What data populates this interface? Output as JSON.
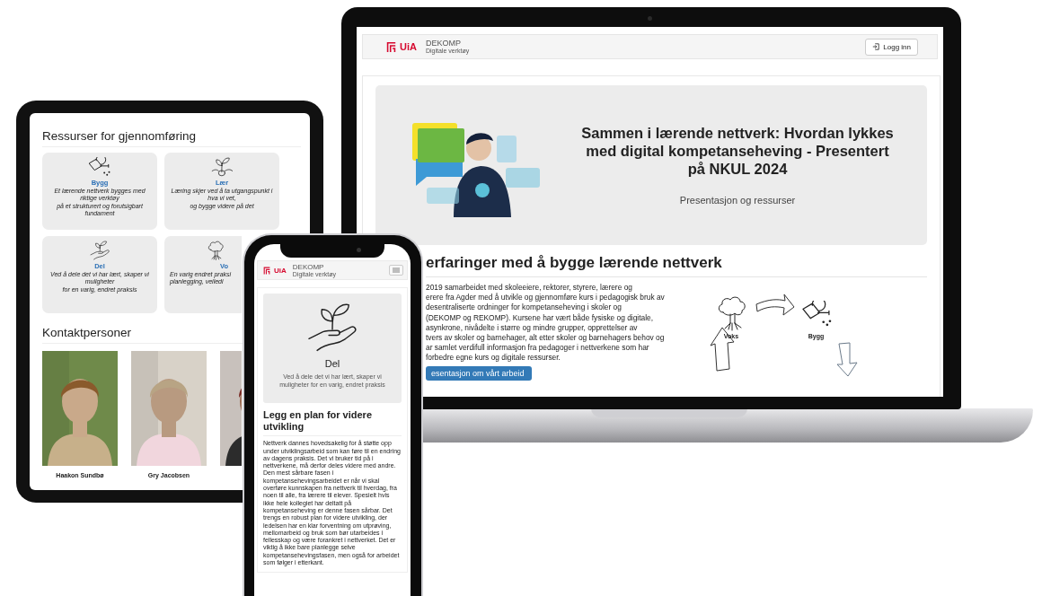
{
  "laptop": {
    "header": {
      "logo": "UiA",
      "brand": "DEKOMP",
      "tagline": "Digitale verktøy",
      "login": "Logg inn"
    },
    "hero": {
      "picture": {
        "kind": "picture"
      },
      "title": "Sammen i lærende nettverk: Hvordan lykkes med digital kompetanseheving - Presentert på NKUL 2024",
      "subtitle": "Presentasjon og ressurser"
    },
    "section": {
      "heading": "erfaringer med å bygge lærende nettverk",
      "lines": [
        "2019 samarbeidet med skoleeiere, rektorer, styrere, lærere og",
        "erere fra Agder med å utvikle og gjennomføre kurs i pedagogisk bruk av",
        "desentraliserte ordninger for kompetanseheving i skoler og",
        "(DEKOMP og REKOMP). Kursene har vært både fysiske og digitale,",
        "asynkrone, nivådelte i større og mindre grupper, opprettelser av",
        "tvers av skoler og barnehager, alt etter skoler og barnehagers behov og",
        "ar samlet verdifull informasjon fra pedagoger i nettverkene som har",
        "forbedre egne kurs og digitale ressurser."
      ],
      "button": "esentasjon om vårt arbeid",
      "diagram_labels": [
        "Voks",
        "Bygg"
      ]
    }
  },
  "tablet": {
    "heading": "Ressurser for gjennomføring",
    "cards": [
      {
        "title": "Bygg",
        "lines": [
          "Et lærende nettverk bygges med riktige verktøy",
          "på et strukturert og forutsigbart fundament"
        ]
      },
      {
        "title": "Lær",
        "lines": [
          "Læring skjer ved å ta utgangspunkt i hva vi vet,",
          "og bygge videre på det"
        ]
      },
      {
        "title": "Del",
        "lines": [
          "Ved å dele det vi har lært, skaper vi muligheter",
          "for en varig, endret praksis"
        ]
      },
      {
        "title": "Vo",
        "lines": [
          "En varig endret praksi",
          "planlegging, veiledi"
        ]
      }
    ],
    "contacts_heading": "Kontaktpersoner",
    "contacts": [
      {
        "kind": "picture",
        "name": "Haakon Sundbø"
      },
      {
        "kind": "picture",
        "name": "Gry Jacobsen"
      },
      {
        "kind": "picture"
      }
    ]
  },
  "phone": {
    "header": {
      "logo": "UiA",
      "brand": "DEKOMP",
      "tagline": "Digitale verktøy"
    },
    "card": {
      "title": "Del",
      "text": "Ved å dele det vi har lært, skaper vi muligheter for en varig, endret praksis"
    },
    "heading": "Legg en plan for videre utvikling",
    "paragraph": "Nettverk dannes hovedsakelig for å støtte opp under utviklingsarbeid som kan føre til en endring av dagens praksis. Det vi bruker tid på i nettverkene, må derfor deles videre med andre. Den mest sårbare fasen i kompetansehevingsarbeidet er når vi skal overføre kunnskapen fra nettverk til hverdag, fra noen til alle, fra lærere til elever. Spesielt hvis ikke hele kollegiet har deltatt på kompetanseheving er denne fasen sårbar. Det trengs en robust plan for videre utvikling, der ledelsen har en klar forventning om utprøving, mellomarbeid og bruk som bør utarbeides i fellesskap og være forankret i nettverket. Det er viktig å ikke bare planlegge selve kompetansehevingsfasen, men også for arbeidet som følger i etterkant."
  }
}
